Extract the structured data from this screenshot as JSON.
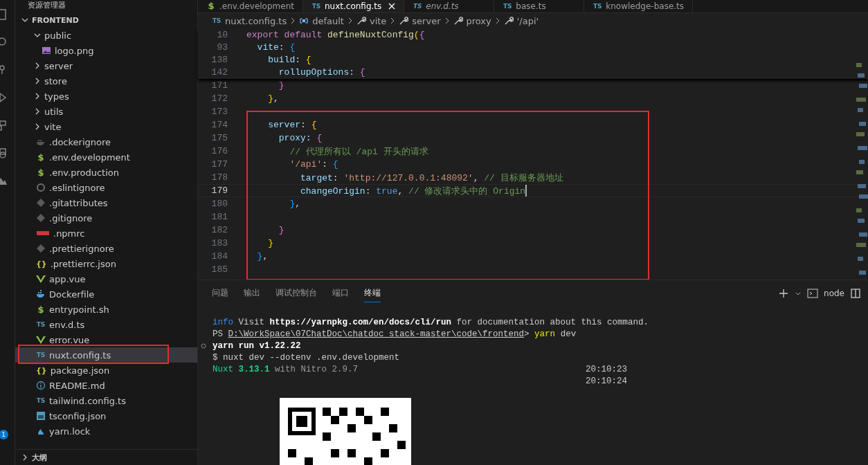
{
  "activity_bar": {
    "badge": "1"
  },
  "explorer": {
    "title": "资源管理器",
    "root": {
      "label": "FRONTEND",
      "expanded": true
    },
    "items": [
      {
        "label": "public",
        "kind": "folder",
        "expanded": true,
        "selected": false,
        "annotated": false,
        "children": [
          {
            "label": "logo.png",
            "kind": "image",
            "selected": false,
            "annotated": false
          }
        ]
      },
      {
        "label": "server",
        "kind": "folder",
        "expanded": false,
        "selected": false,
        "annotated": false
      },
      {
        "label": "store",
        "kind": "folder",
        "expanded": false,
        "selected": false,
        "annotated": false
      },
      {
        "label": "types",
        "kind": "folder",
        "expanded": false,
        "selected": false,
        "annotated": false
      },
      {
        "label": "utils",
        "kind": "folder",
        "expanded": false,
        "selected": false,
        "annotated": false
      },
      {
        "label": "vite",
        "kind": "folder",
        "expanded": false,
        "selected": false,
        "annotated": false
      },
      {
        "label": ".dockerignore",
        "kind": "dockerignore",
        "selected": false,
        "annotated": false
      },
      {
        "label": ".env.development",
        "kind": "env",
        "icon": "$",
        "selected": false,
        "annotated": false
      },
      {
        "label": ".env.production",
        "kind": "env",
        "icon": "$",
        "selected": false,
        "annotated": false
      },
      {
        "label": ".eslintignore",
        "kind": "eslint",
        "selected": false,
        "annotated": false
      },
      {
        "label": ".gitattributes",
        "kind": "git",
        "selected": false,
        "annotated": false
      },
      {
        "label": ".gitignore",
        "kind": "git",
        "selected": false,
        "annotated": false
      },
      {
        "label": ".npmrc",
        "kind": "npm",
        "selected": false,
        "annotated": false
      },
      {
        "label": ".prettierignore",
        "kind": "git",
        "selected": false,
        "annotated": false
      },
      {
        "label": ".prettierrc.json",
        "kind": "json",
        "icon": "{}",
        "selected": false,
        "annotated": false
      },
      {
        "label": "app.vue",
        "kind": "vue",
        "selected": false,
        "annotated": false
      },
      {
        "label": "Dockerfile",
        "kind": "docker",
        "selected": false,
        "annotated": false
      },
      {
        "label": "entrypoint.sh",
        "kind": "env",
        "icon": "$",
        "selected": false,
        "annotated": false
      },
      {
        "label": "env.d.ts",
        "kind": "ts",
        "icon": "TS",
        "selected": false,
        "annotated": false
      },
      {
        "label": "error.vue",
        "kind": "vue",
        "selected": false,
        "annotated": false
      },
      {
        "label": "nuxt.config.ts",
        "kind": "ts",
        "icon": "TS",
        "selected": true,
        "annotated": true
      },
      {
        "label": "package.json",
        "kind": "json",
        "icon": "{}",
        "selected": false,
        "annotated": false
      },
      {
        "label": "README.md",
        "kind": "info",
        "selected": false,
        "annotated": false
      },
      {
        "label": "tailwind.config.ts",
        "kind": "ts",
        "icon": "TS",
        "selected": false,
        "annotated": false
      },
      {
        "label": "tsconfig.json",
        "kind": "tsconfig",
        "selected": false,
        "annotated": false
      },
      {
        "label": "yarn.lock",
        "kind": "yarn",
        "selected": false,
        "annotated": false
      }
    ],
    "outline": {
      "label": "大纲",
      "expanded": false
    }
  },
  "tabs": [
    {
      "label": ".env.development",
      "kind": "env",
      "icon": "$",
      "selected": false,
      "preview": false
    },
    {
      "label": "nuxt.config.ts",
      "kind": "ts",
      "icon": "TS",
      "selected": true,
      "preview": false
    },
    {
      "label": "env.d.ts",
      "kind": "ts",
      "icon": "TS",
      "selected": false,
      "preview": true
    },
    {
      "label": "base.ts",
      "kind": "ts",
      "icon": "TS",
      "selected": false,
      "preview": false
    },
    {
      "label": "knowledge-base.ts",
      "kind": "ts",
      "icon": "TS",
      "selected": false,
      "preview": false
    }
  ],
  "breadcrumbs": [
    {
      "label": "nuxt.config.ts",
      "kind": "ts",
      "icon": "TS"
    },
    {
      "label": "default",
      "kind": "module"
    },
    {
      "label": "vite",
      "kind": "property"
    },
    {
      "label": "server",
      "kind": "property"
    },
    {
      "label": "proxy",
      "kind": "property"
    },
    {
      "label": "'/api'",
      "kind": "property"
    }
  ],
  "sticky_lines": [
    {
      "number": "10",
      "segments": [
        {
          "kind": "kw",
          "text": "export default "
        },
        {
          "kind": "fn",
          "text": "defineNuxtConfig"
        },
        {
          "kind": "b1",
          "text": "("
        },
        {
          "kind": "b2",
          "text": "{"
        }
      ]
    },
    {
      "number": "93",
      "segments": [
        {
          "kind": "prop",
          "text": "  vite"
        },
        {
          "kind": "plain",
          "text": ": "
        },
        {
          "kind": "b3",
          "text": "{"
        }
      ]
    },
    {
      "number": "138",
      "segments": [
        {
          "kind": "prop",
          "text": "    build"
        },
        {
          "kind": "plain",
          "text": ": "
        },
        {
          "kind": "b1",
          "text": "{"
        }
      ]
    },
    {
      "number": "142",
      "segments": [
        {
          "kind": "prop",
          "text": "      rollupOptions"
        },
        {
          "kind": "plain",
          "text": ": "
        },
        {
          "kind": "b2",
          "text": "{"
        }
      ]
    }
  ],
  "lines": [
    {
      "number": "171",
      "current": false,
      "annotated": false,
      "segments": [
        {
          "kind": "b2",
          "text": "      }"
        }
      ]
    },
    {
      "number": "172",
      "current": false,
      "annotated": false,
      "segments": [
        {
          "kind": "b1",
          "text": "    }"
        },
        {
          "kind": "plain",
          "text": ","
        }
      ]
    },
    {
      "number": "173",
      "current": false,
      "annotated": false
    },
    {
      "number": "174",
      "current": false,
      "annotated": true,
      "segments": [
        {
          "kind": "prop",
          "text": "    server"
        },
        {
          "kind": "plain",
          "text": ": "
        },
        {
          "kind": "b1",
          "text": "{"
        }
      ]
    },
    {
      "number": "175",
      "current": false,
      "annotated": true,
      "segments": [
        {
          "kind": "prop",
          "text": "      proxy"
        },
        {
          "kind": "plain",
          "text": ": "
        },
        {
          "kind": "b2",
          "text": "{"
        }
      ]
    },
    {
      "number": "176",
      "current": false,
      "annotated": true,
      "segments": [
        {
          "kind": "com",
          "text": "        // 代理所有以 /api 开头的请求"
        }
      ]
    },
    {
      "number": "177",
      "current": false,
      "annotated": true,
      "segments": [
        {
          "kind": "str",
          "text": "        '/api'"
        },
        {
          "kind": "plain",
          "text": ": "
        },
        {
          "kind": "b3",
          "text": "{"
        }
      ]
    },
    {
      "number": "178",
      "current": false,
      "annotated": true,
      "segments": [
        {
          "kind": "prop",
          "text": "          target"
        },
        {
          "kind": "plain",
          "text": ": "
        },
        {
          "kind": "str",
          "text": "'http://127.0.0.1:48092'"
        },
        {
          "kind": "plain",
          "text": ", "
        },
        {
          "kind": "com",
          "text": "// 目标服务器地址"
        }
      ]
    },
    {
      "number": "179",
      "current": true,
      "annotated": true,
      "segments": [
        {
          "kind": "prop",
          "text": "          changeOrigin"
        },
        {
          "kind": "plain",
          "text": ": "
        },
        {
          "kind": "bool",
          "text": "true"
        },
        {
          "kind": "plain",
          "text": ", "
        },
        {
          "kind": "com",
          "text": "// 修改请求头中的 Origin"
        }
      ]
    },
    {
      "number": "180",
      "current": false,
      "annotated": true,
      "segments": [
        {
          "kind": "b3",
          "text": "        }"
        },
        {
          "kind": "plain",
          "text": ","
        }
      ]
    },
    {
      "number": "181",
      "current": false,
      "annotated": true
    },
    {
      "number": "182",
      "current": false,
      "annotated": true,
      "segments": [
        {
          "kind": "b2",
          "text": "      }"
        }
      ]
    },
    {
      "number": "183",
      "current": false,
      "annotated": true,
      "segments": [
        {
          "kind": "b1",
          "text": "    }"
        }
      ]
    },
    {
      "number": "184",
      "current": false,
      "annotated": true,
      "segments": [
        {
          "kind": "b3",
          "text": "  }"
        },
        {
          "kind": "plain",
          "text": ","
        }
      ]
    },
    {
      "number": "185",
      "current": false,
      "annotated": true
    }
  ],
  "panel": {
    "tabs": [
      {
        "label": "问题",
        "selected": false
      },
      {
        "label": "输出",
        "selected": false
      },
      {
        "label": "调试控制台",
        "selected": false
      },
      {
        "label": "端口",
        "selected": false
      },
      {
        "label": "终端",
        "selected": true
      }
    ],
    "terminal_name": "node",
    "terminal_lines": [
      {
        "marked": false,
        "segments": [
          {
            "kind": "info",
            "text": "info"
          },
          {
            "kind": "plain",
            "text": " Visit "
          },
          {
            "kind": "bold",
            "text": "https://yarnpkg.com/en/docs/cli/run"
          },
          {
            "kind": "plain",
            "text": " for documentation about this command."
          }
        ]
      },
      {
        "marked": false,
        "segments": [
          {
            "kind": "plain",
            "text": "PS "
          },
          {
            "kind": "path",
            "text": "D:\\WorkSpace\\07ChatDoc\\chatdoc_stack-master\\code\\frontend"
          },
          {
            "kind": "plain",
            "text": "> "
          },
          {
            "kind": "cmd",
            "text": "yarn"
          },
          {
            "kind": "plain",
            "text": " dev"
          }
        ]
      },
      {
        "marked": true,
        "segments": [
          {
            "kind": "bold",
            "text": "yarn run v1.22.22"
          }
        ]
      },
      {
        "marked": false,
        "segments": [
          {
            "kind": "plain",
            "text": "$ nuxt dev --dotenv .env.development"
          }
        ]
      },
      {
        "marked": false,
        "segments": [
          {
            "kind": "green",
            "text": "Nuxt "
          },
          {
            "kind": "greenbold",
            "text": "3.13.1"
          },
          {
            "kind": "dim",
            "text": " with Nitro 2.9.7"
          }
        ],
        "time": "20:10:23"
      },
      {
        "marked": false,
        "time": "20:10:24"
      }
    ]
  }
}
